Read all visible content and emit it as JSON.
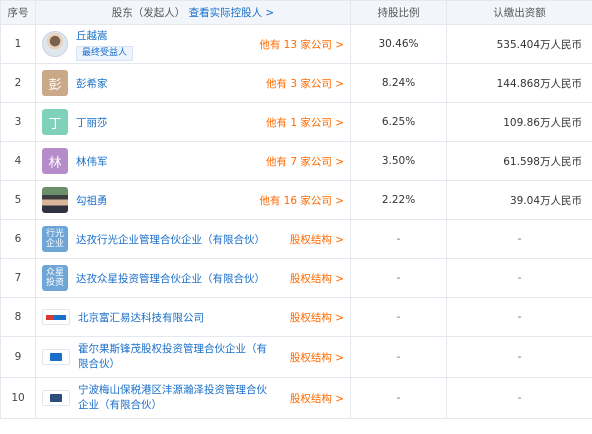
{
  "header": {
    "idx": "序号",
    "holder": "股东（发起人）",
    "holder_link": "查看实际控股人 >",
    "ratio": "持股比例",
    "capital": "认缴出资额"
  },
  "rows": [
    {
      "idx": "1",
      "name": "丘越嵩",
      "badge": "最终受益人",
      "side": "他有 13 家公司 >",
      "ratio": "30.46%",
      "capital": "535.404万人民币",
      "avatar_text": ""
    },
    {
      "idx": "2",
      "name": "彭希家",
      "side": "他有 3 家公司 >",
      "ratio": "8.24%",
      "capital": "144.868万人民币",
      "avatar_text": "彭"
    },
    {
      "idx": "3",
      "name": "丁丽莎",
      "side": "他有 1 家公司 >",
      "ratio": "6.25%",
      "capital": "109.86万人民币",
      "avatar_text": "丁"
    },
    {
      "idx": "4",
      "name": "林伟军",
      "side": "他有 7 家公司 >",
      "ratio": "3.50%",
      "capital": "61.598万人民币",
      "avatar_text": "林"
    },
    {
      "idx": "5",
      "name": "勾祖勇",
      "side": "他有 16 家公司 >",
      "ratio": "2.22%",
      "capital": "39.04万人民币",
      "avatar_text": ""
    },
    {
      "idx": "6",
      "name": "达孜行光企业管理合伙企业（有限合伙）",
      "side": "股权结构 >",
      "ratio": "-",
      "capital": "-",
      "avatar_text": "行光企业"
    },
    {
      "idx": "7",
      "name": "达孜众星投资管理合伙企业（有限合伙）",
      "side": "股权结构 >",
      "ratio": "-",
      "capital": "-",
      "avatar_text": "众星投资"
    },
    {
      "idx": "8",
      "name": "北京富汇易达科技有限公司",
      "side": "股权结构 >",
      "ratio": "-",
      "capital": "-",
      "avatar_text": ""
    },
    {
      "idx": "9",
      "name": "霍尔果斯锋茂股权投资管理合伙企业（有限合伙）",
      "side": "股权结构 >",
      "ratio": "-",
      "capital": "-",
      "avatar_text": ""
    },
    {
      "idx": "10",
      "name": "宁波梅山保税港区沣源瀚泽投资管理合伙企业（有限合伙）",
      "side": "股权结构 >",
      "ratio": "-",
      "capital": "-",
      "avatar_text": ""
    }
  ],
  "colors": {
    "link": "#1a6fc9",
    "accent": "#ff6a00",
    "header_bg": "#f2f6fb",
    "border": "#e4e9f0",
    "avatar_peng": "#c9a987",
    "avatar_ding": "#7fd1b9",
    "avatar_lin": "#b58cc9",
    "avatar_xingguang": "#6fa6d8",
    "avatar_zhongxing": "#6fa6d8"
  },
  "icons": {
    "row1_avatar": "person-photo-icon",
    "row5_avatar": "person-photo-icon",
    "row8_avatar": "company-logo-icon",
    "row9_avatar": "company-logo-icon",
    "row10_avatar": "company-logo-icon"
  }
}
